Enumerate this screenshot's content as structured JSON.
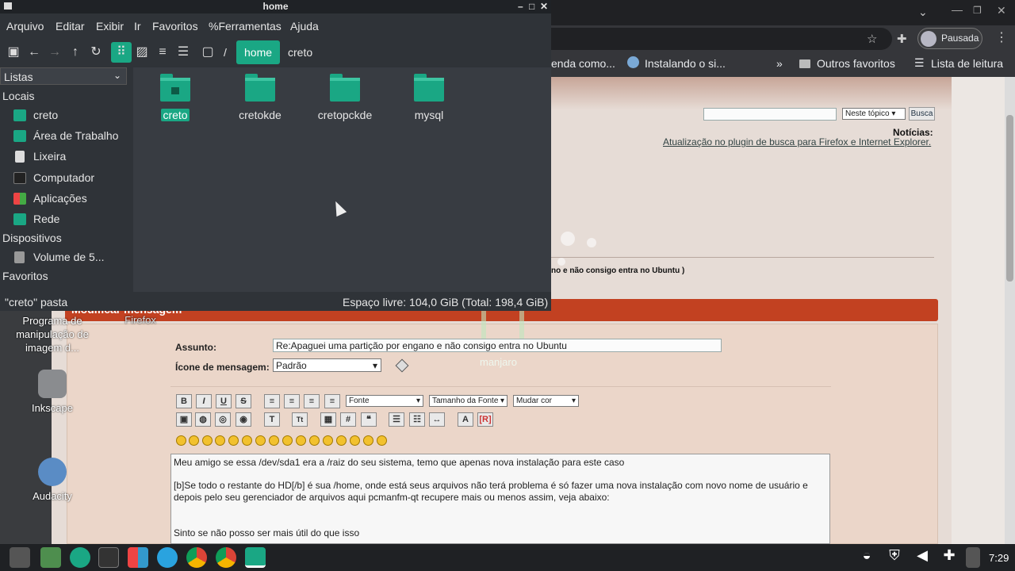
{
  "file_manager": {
    "title": "home",
    "menu": [
      "Arquivo",
      "Editar",
      "Exibir",
      "Ir",
      "Favoritos",
      "%Ferramentas",
      "Ajuda"
    ],
    "breadcrumb": [
      "/",
      "home",
      "creto"
    ],
    "side_dropdown": "Listas",
    "side_sections": {
      "locais": "Locais",
      "dispositivos": "Dispositivos",
      "favoritos": "Favoritos"
    },
    "locais_items": [
      "creto",
      "Área de Trabalho",
      "Lixeira",
      "Computador",
      "Aplicações",
      "Rede"
    ],
    "device_items": [
      "Volume de 5..."
    ],
    "folders": [
      "creto",
      "cretokde",
      "cretopckde",
      "mysql"
    ],
    "status_left": "\"creto\" pasta",
    "status_right": "Espaço livre: 104,0 GiB (Total: 198,4 GiB)"
  },
  "browser": {
    "profile_label": "Pausada",
    "bookmarks": [
      "enda como...",
      "Instalando o si...",
      "»",
      "Outros favoritos",
      "Lista de leitura"
    ],
    "page": {
      "search_scope": "Neste tópico",
      "search_button": "Busca",
      "news_title": "Notícias:",
      "news_link": "Atualização no plugin de busca para Firefox e Internet Explorer.",
      "topic_fragment": "no e não consigo entra no Ubuntu )",
      "section_header": "Modificar mensagem",
      "assunto_label": "Assunto:",
      "assunto_value": "Re:Apaguei uma partição por engano e não consigo entra no Ubuntu",
      "icone_label": "Ícone de mensagem:",
      "icone_value": "Padrão",
      "font_select": "Fonte",
      "size_select": "Tamanho da Fonte",
      "color_select": "Mudar cor",
      "message_lines": [
        "Meu amigo se essa /dev/sda1 era a /raiz do seu sistema, temo que apenas nova instalação para este caso",
        "[b]Se todo o restante do HD[/b] é sua /home, onde está seus arquivos não terá problema é só fazer uma nova instalação com novo nome de usuário e depois pelo seu gerenciador de arquivos aqui pcmanfm-qt recupere mais ou menos assim, veja abaixo:",
        "Sinto se não posso ser mais útil do que isso"
      ]
    }
  },
  "desktop": {
    "icons": [
      "Programa de manipulação de imagem d...",
      "Firefox",
      "Inkscape",
      "Audacity"
    ],
    "watermark": "manjaro"
  },
  "taskbar": {
    "clock": "7:29"
  },
  "colors": {
    "accent": "#1aa784",
    "red_bar": "#c24121"
  }
}
